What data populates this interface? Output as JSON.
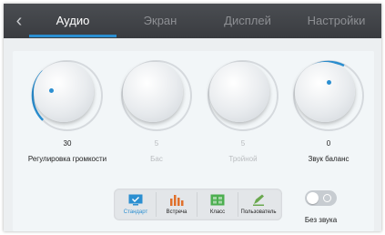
{
  "tabs": [
    {
      "label": "Аудио",
      "active": true
    },
    {
      "label": "Экран",
      "active": false
    },
    {
      "label": "Дисплей",
      "active": false
    },
    {
      "label": "Настройки",
      "active": false
    }
  ],
  "knobs": [
    {
      "value": "30",
      "label": "Регулировка громкости",
      "enabled": true
    },
    {
      "value": "5",
      "label": "Бас",
      "enabled": false
    },
    {
      "value": "5",
      "label": "Тройной",
      "enabled": false
    },
    {
      "value": "0",
      "label": "Звук баланс",
      "enabled": true
    }
  ],
  "modes": [
    {
      "label": "Стандарт",
      "icon": "monitor-check-icon",
      "active": true
    },
    {
      "label": "Встреча",
      "icon": "bar-chart-icon",
      "active": false
    },
    {
      "label": "Класс",
      "icon": "grid-board-icon",
      "active": false
    },
    {
      "label": "Пользователь",
      "icon": "pencil-icon",
      "active": false
    }
  ],
  "mute": {
    "label": "Без звука",
    "on": false
  },
  "colors": {
    "accent": "#2b8fd1",
    "meeting": "#e0702b",
    "class": "#4caf50",
    "user": "#6aa84f"
  }
}
